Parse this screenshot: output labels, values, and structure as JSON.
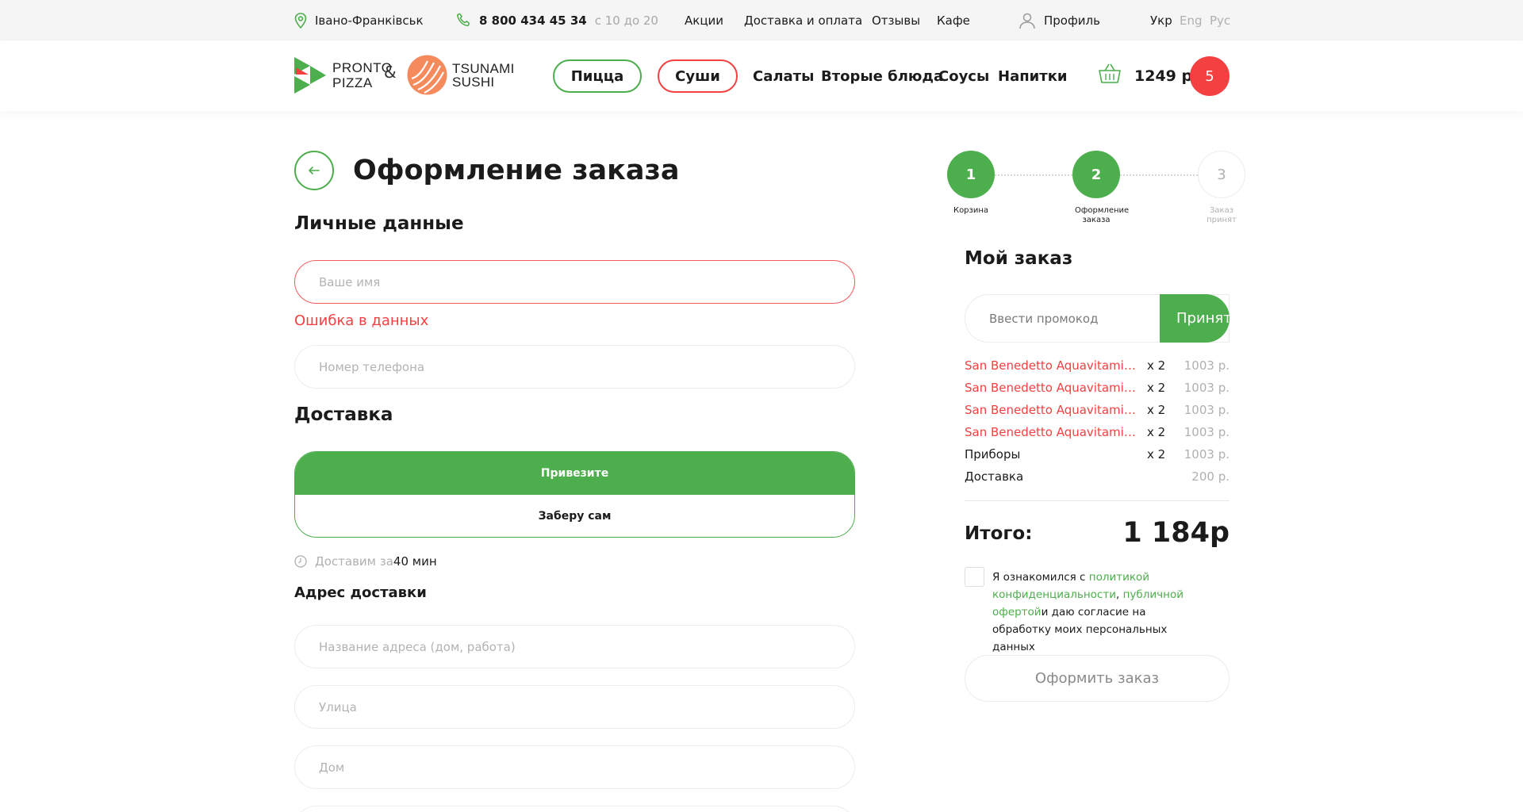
{
  "topbar": {
    "city": "Івано-Франківськ",
    "phone": "8 800 434 45 34",
    "hours": "с 10 до 20",
    "menu": [
      "Акции",
      "Доставка и оплата",
      "Отзывы",
      "Кафе"
    ],
    "profile": "Профиль",
    "languages": [
      "Укр",
      "Eng",
      "Рус"
    ]
  },
  "header": {
    "logo_pronto": [
      "PRONTO",
      "PIZZA"
    ],
    "amp": "&",
    "logo_sushi": [
      "TSUNAMI",
      "SUSHI"
    ],
    "categories": [
      "Пицца",
      "Суши",
      "Салаты",
      "Вторые блюда",
      "Соусы",
      "Напитки"
    ],
    "cart_sum": "1249 р",
    "cart_count": "5"
  },
  "checkout": {
    "title": "Оформление заказа",
    "personal_heading": "Личные данные",
    "name_placeholder": "Ваше имя",
    "error_text": "Ошибка в данных",
    "phone_placeholder": "Номер телефона",
    "delivery_heading": "Доставка",
    "delivery_options": [
      "Привезите",
      "Заберу сам"
    ],
    "delivery_time_label": "Доставим за",
    "delivery_time_value": "40 мин",
    "address_heading": "Адрес доставки",
    "address_name_placeholder": "Название адреса (дом, работа)",
    "street_placeholder": "Улица",
    "house_placeholder": "Дом"
  },
  "steps": [
    {
      "num": "1",
      "label": "Корзина"
    },
    {
      "num": "2",
      "label": "Оформление заказа"
    },
    {
      "num": "3",
      "label": "Заказ принят"
    }
  ],
  "order": {
    "heading": "Мой заказ",
    "promo_placeholder": "Ввести промокод",
    "promo_button": "Принять",
    "items": [
      {
        "name": "San Benedetto Aquavitamin a...",
        "qty": "x 2",
        "price": "1003 р."
      },
      {
        "name": "San Benedetto Aquavitamin a...",
        "qty": "x 2",
        "price": "1003 р."
      },
      {
        "name": "San Benedetto Aquavitamin a...",
        "qty": "x 2",
        "price": "1003 р."
      },
      {
        "name": "San Benedetto Aquavitamin a...",
        "qty": "x 2",
        "price": "1003 р."
      },
      {
        "name": "Приборы",
        "qty": "x 2",
        "price": "1003 р."
      },
      {
        "name": "Доставка",
        "qty": "",
        "price": "200 р."
      }
    ],
    "total_label": "Итого:",
    "total_value": "1 184р",
    "agree_text_1": "Я ознакомился с ",
    "agree_link_1": "политикой конфиденциальности",
    "agree_sep": ", ",
    "agree_link_2": "публичной офертой",
    "agree_text_2": "и даю согласие на обработку моих персональных данных",
    "submit": "Оформить заказ"
  },
  "colors": {
    "green": "#4cae4c",
    "red": "#f44040",
    "topbar_bg": "#f5f5f5"
  }
}
